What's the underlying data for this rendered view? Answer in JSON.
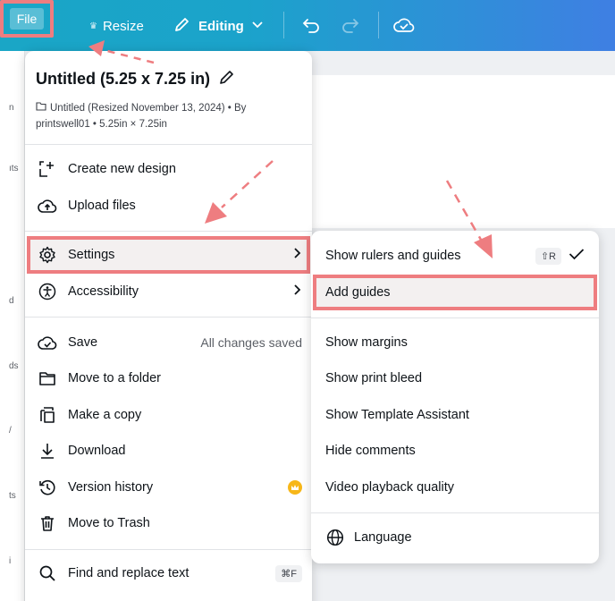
{
  "topbar": {
    "file_label": "File",
    "resize_label": "Resize",
    "editing_label": "Editing"
  },
  "left_strip": {
    "labels": [
      "n",
      "ıts",
      "d",
      "ds",
      "/",
      "ts",
      "i"
    ]
  },
  "file_menu": {
    "title": "Untitled (5.25 x 7.25 in)",
    "subtitle_line1": "Untitled (Resized November 13, 2024) • By",
    "subtitle_line2": "printswell01 • 5.25in × 7.25in",
    "items": [
      {
        "label": "Create new design",
        "icon": "plus-bracket-icon"
      },
      {
        "label": "Upload files",
        "icon": "cloud-upload-icon"
      },
      {
        "label": "Settings",
        "icon": "gear-icon"
      },
      {
        "label": "Accessibility",
        "icon": "accessibility-icon"
      },
      {
        "label": "Save",
        "icon": "cloud-check-icon",
        "status": "All changes saved"
      },
      {
        "label": "Move to a folder",
        "icon": "folder-icon"
      },
      {
        "label": "Make a copy",
        "icon": "copy-icon"
      },
      {
        "label": "Download",
        "icon": "download-icon"
      },
      {
        "label": "Version history",
        "icon": "history-icon"
      },
      {
        "label": "Move to Trash",
        "icon": "trash-icon"
      },
      {
        "label": "Find and replace text",
        "icon": "search-icon",
        "shortcut": "⌘F"
      }
    ]
  },
  "settings_submenu": {
    "items": [
      {
        "label": "Show rulers and guides",
        "shortcut": "⇧R"
      },
      {
        "label": "Add guides"
      },
      {
        "label": "Show margins"
      },
      {
        "label": "Show print bleed"
      },
      {
        "label": "Show Template Assistant"
      },
      {
        "label": "Hide comments"
      },
      {
        "label": "Video playback quality"
      },
      {
        "label": "Language",
        "icon": "globe-icon"
      }
    ]
  },
  "colors": {
    "highlight_border": "#ee7d80",
    "topbar_start": "#1aa6c6",
    "topbar_end": "#3f7fe3",
    "crown": "#f7b719"
  }
}
